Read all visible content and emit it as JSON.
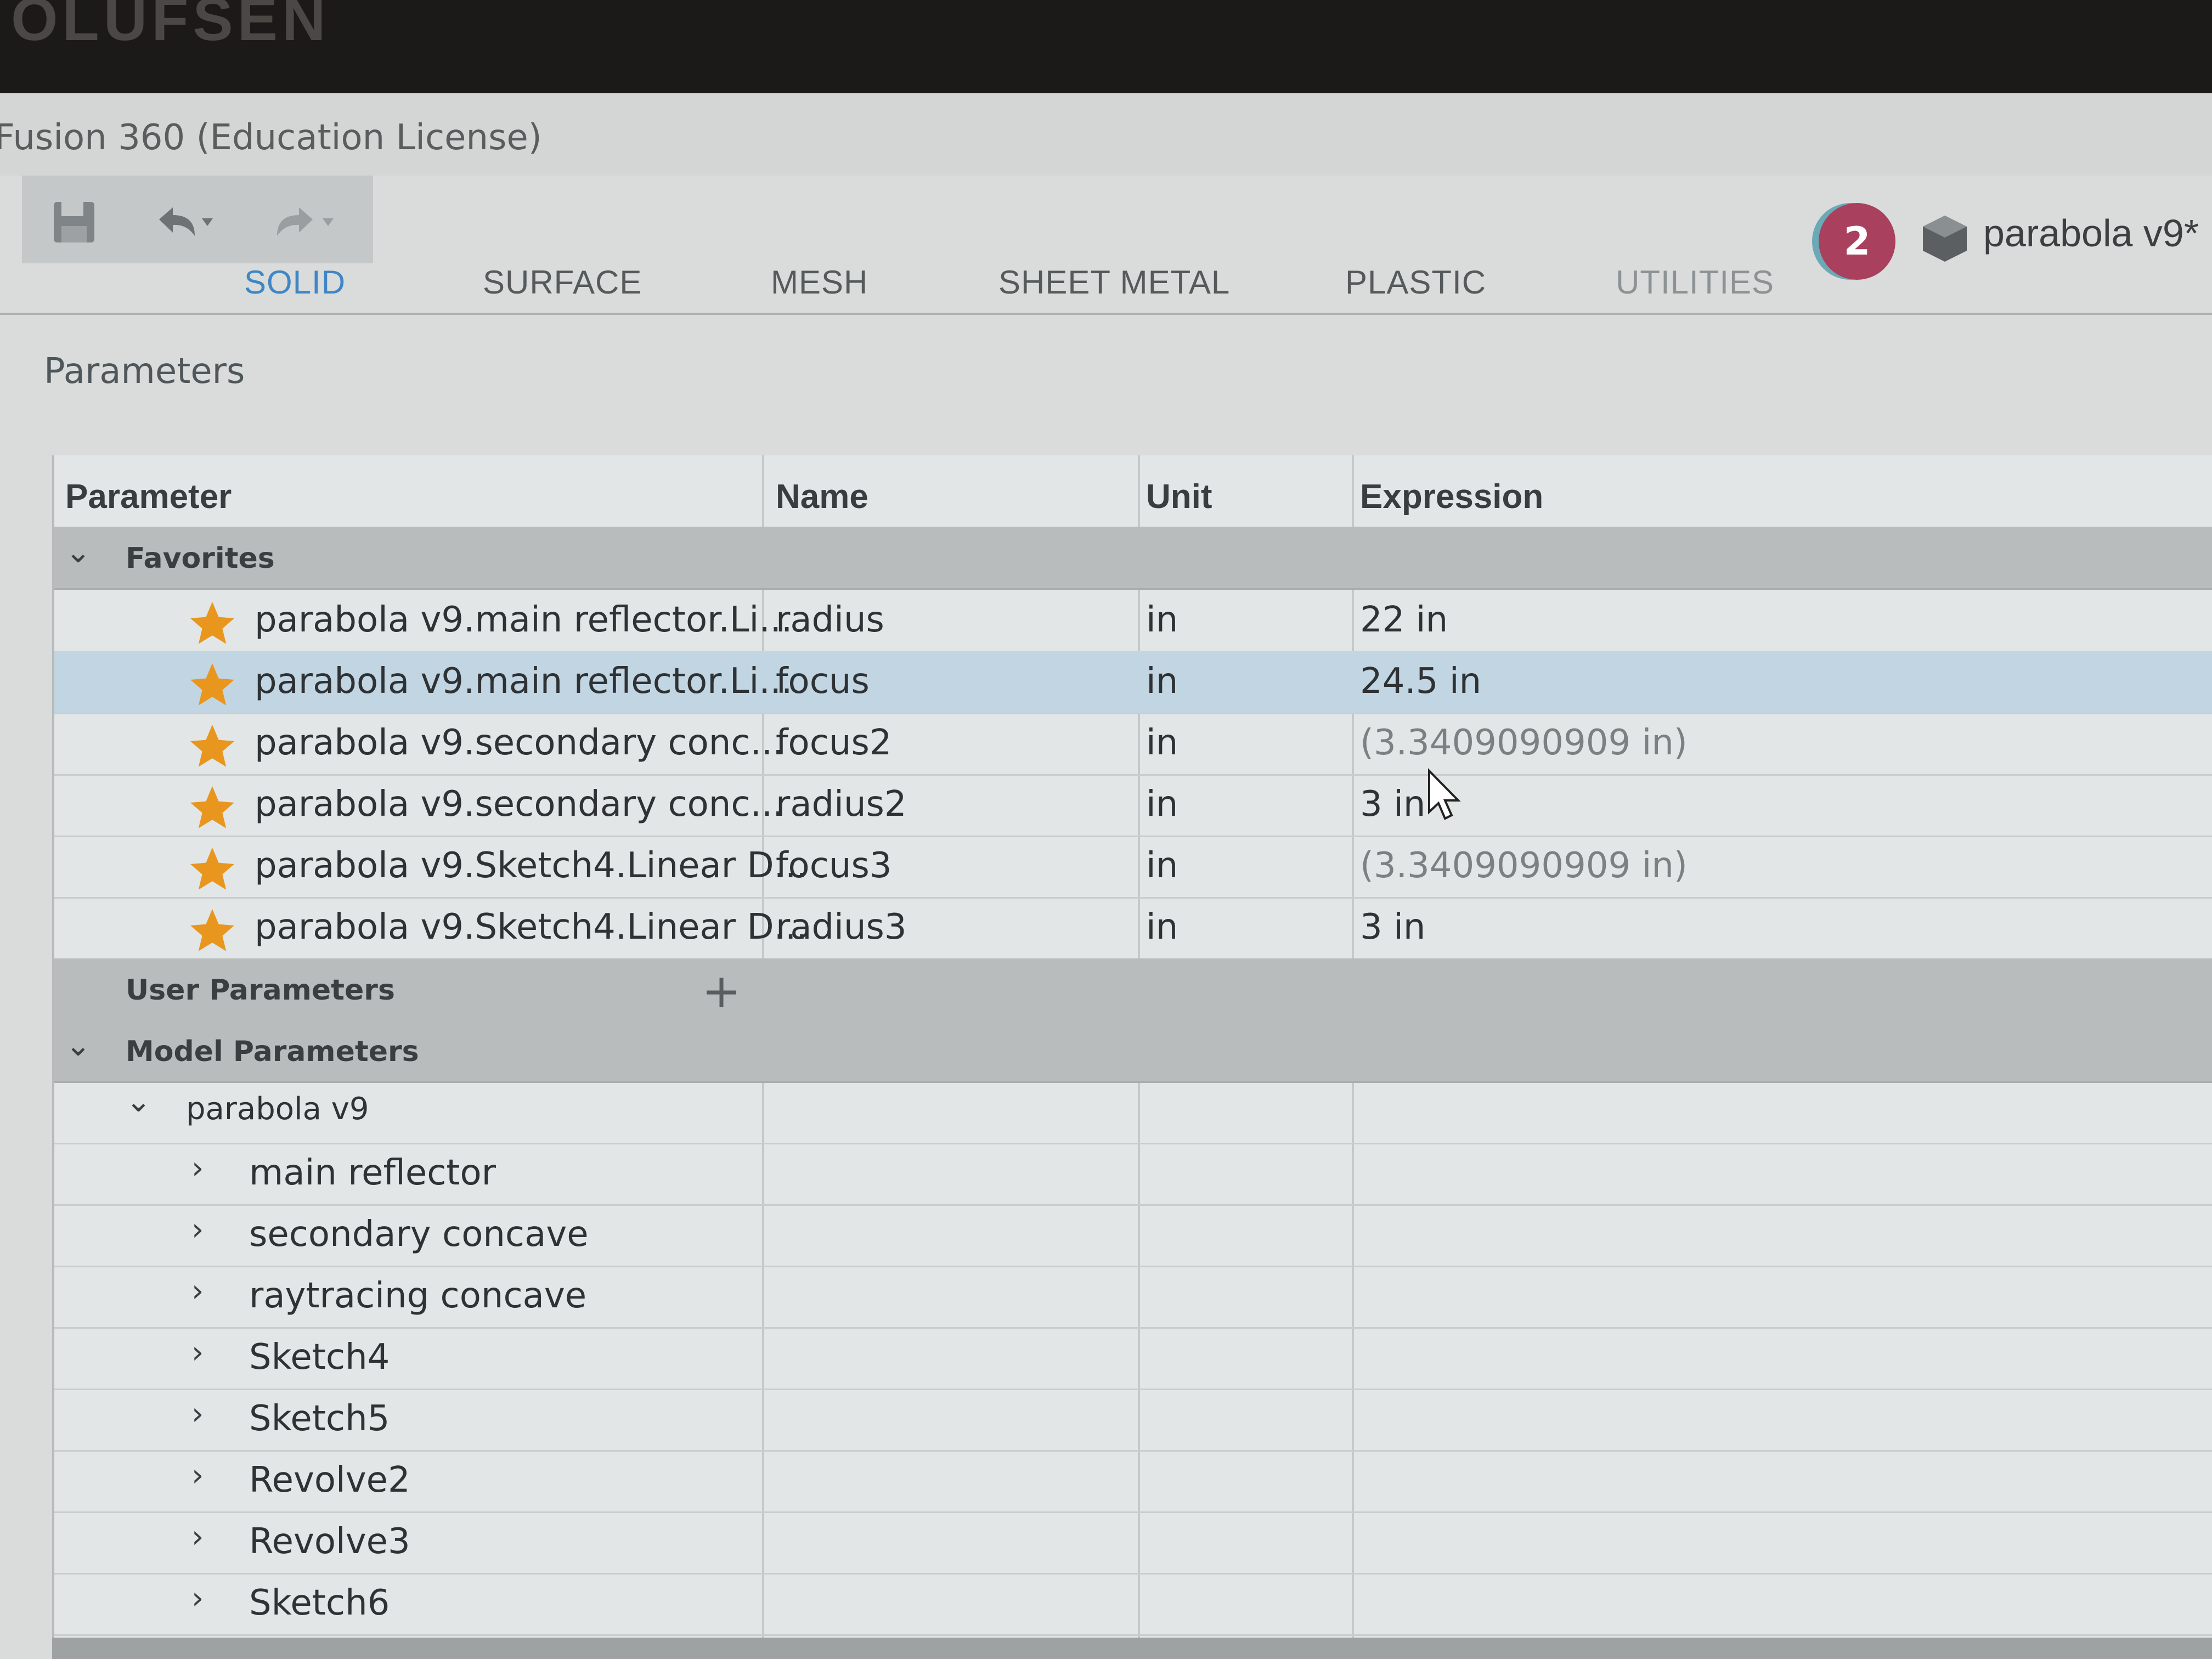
{
  "bezel": {
    "brand": "OLUFSEN"
  },
  "app": {
    "title": "Fusion 360 (Education License)"
  },
  "toolbar": {
    "icons": [
      "save-icon",
      "undo-icon",
      "redo-icon"
    ]
  },
  "tabs": [
    "SOLID",
    "SURFACE",
    "MESH",
    "SHEET METAL",
    "PLASTIC",
    "UTILITIES"
  ],
  "active_tab": "SOLID",
  "document": {
    "notifications": "2",
    "name": "parabola v9*"
  },
  "panel": {
    "title": "Parameters"
  },
  "table": {
    "headers": {
      "parameter": "Parameter",
      "name": "Name",
      "unit": "Unit",
      "expression": "Expression"
    },
    "favorites_label": "Favorites",
    "favorites": [
      {
        "parameter": "parabola v9.main reflector.Li...",
        "name": "radius",
        "unit": "in",
        "expression": "22 in",
        "computed": false
      },
      {
        "parameter": "parabola v9.main reflector.Li...",
        "name": "focus",
        "unit": "in",
        "expression": "24.5 in",
        "computed": false
      },
      {
        "parameter": "parabola v9.secondary conc...",
        "name": "focus2",
        "unit": "in",
        "expression": "(3.3409090909 in)",
        "computed": true
      },
      {
        "parameter": "parabola v9.secondary conc...",
        "name": "radius2",
        "unit": "in",
        "expression": "3 in",
        "computed": false
      },
      {
        "parameter": "parabola v9.Sketch4.Linear D...",
        "name": "focus3",
        "unit": "in",
        "expression": "(3.3409090909 in)",
        "computed": true
      },
      {
        "parameter": "parabola v9.Sketch4.Linear D...",
        "name": "radius3",
        "unit": "in",
        "expression": "3 in",
        "computed": false
      }
    ],
    "user_params_label": "User Parameters",
    "model_params_label": "Model Parameters",
    "component": "parabola v9",
    "children": [
      "main reflector",
      "secondary concave",
      "raytracing concave",
      "Sketch4",
      "Sketch5",
      "Revolve2",
      "Revolve3",
      "Sketch6"
    ]
  },
  "colors": {
    "accent": "#3e86c6",
    "star": "#e8961e",
    "badge": "#a8405e"
  }
}
